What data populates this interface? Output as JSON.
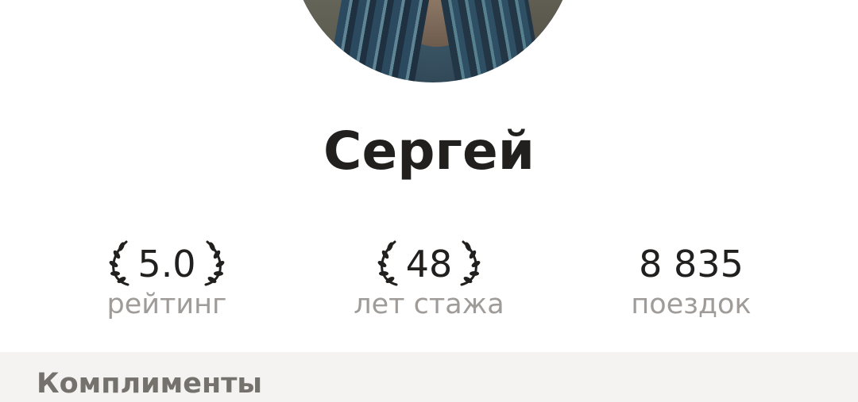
{
  "profile": {
    "name": "Сергей"
  },
  "stats": [
    {
      "value": "5.0",
      "label": "рейтинг",
      "laurels": true
    },
    {
      "value": "48",
      "label": "лет стажа",
      "laurels": true
    },
    {
      "value": "8 835",
      "label": "поездок",
      "laurels": false
    }
  ],
  "sections": {
    "compliments_title": "Комплименты"
  },
  "colors": {
    "text_primary": "#21201f",
    "text_secondary": "#9e9b98",
    "section_background": "#f4f3f1"
  },
  "icons": {
    "laurel": "laurel-wreath-icon"
  }
}
